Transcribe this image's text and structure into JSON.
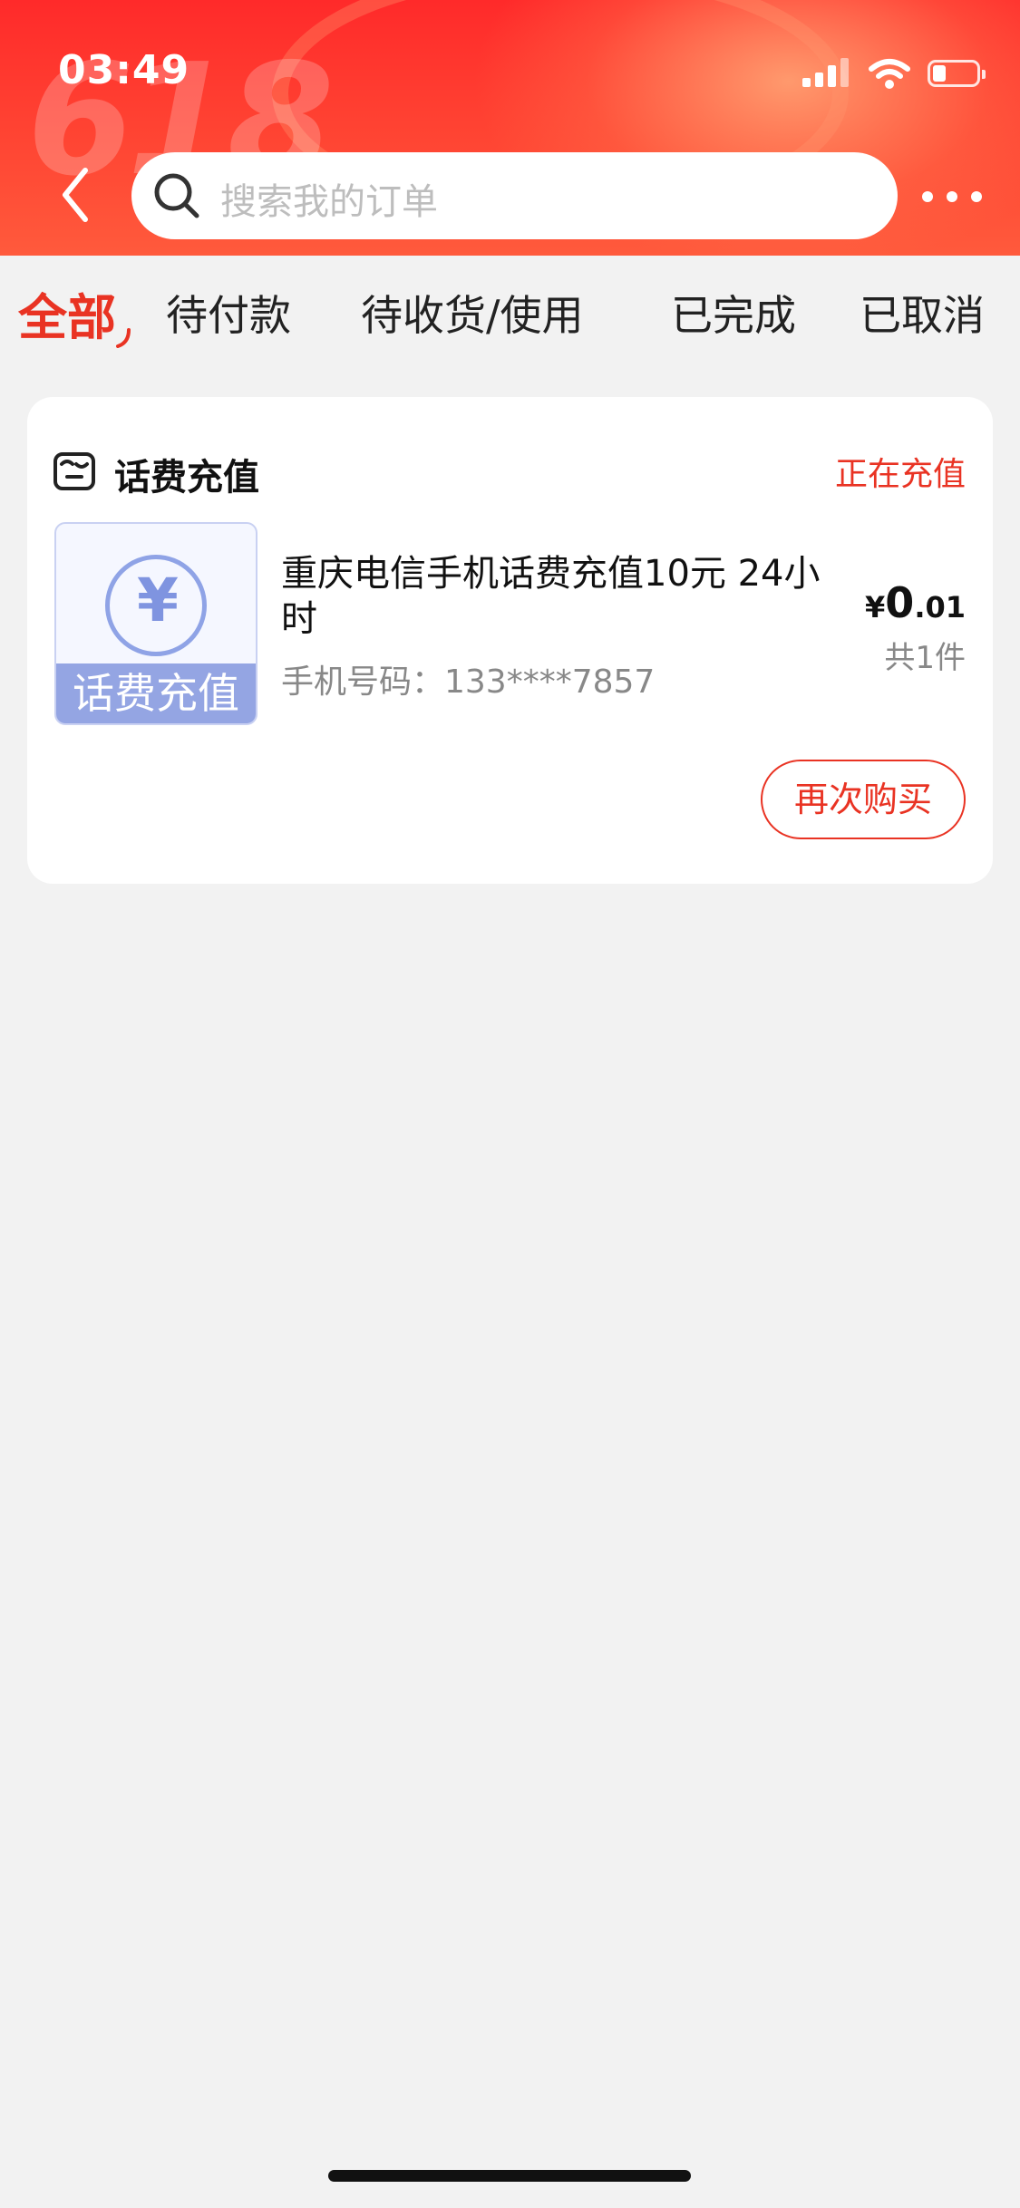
{
  "status_bar": {
    "time": "03:49"
  },
  "header": {
    "watermark": "618",
    "search_placeholder": "搜索我的订单"
  },
  "tabs": [
    {
      "label": "全部",
      "active": true
    },
    {
      "label": "待付款",
      "active": false
    },
    {
      "label": "待收货/使用",
      "active": false
    },
    {
      "label": "已完成",
      "active": false
    },
    {
      "label": "已取消",
      "active": false
    }
  ],
  "order": {
    "shop_name": "话费充值",
    "status": "正在充值",
    "thumb_symbol": "¥",
    "thumb_label": "话费充值",
    "title": "重庆电信手机话费充值10元 24小时",
    "phone": "手机号码：133****7857",
    "price_currency": "¥",
    "price_int": "0",
    "price_dec": ".01",
    "count": "共1件",
    "rebuy_label": "再次购买"
  },
  "colors": {
    "accent": "#e93323",
    "background": "#f2f2f2"
  }
}
